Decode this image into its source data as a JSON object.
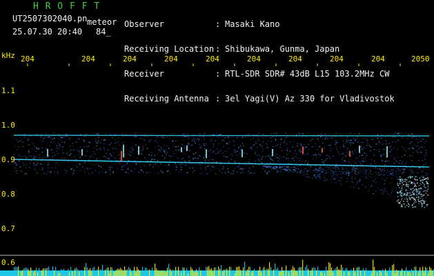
{
  "header": {
    "title": "H R O F F T",
    "filename": "UT2507302040.pn",
    "meteor_label": "meteor",
    "datetime": "25.07.30 20:40",
    "count": "84_",
    "labels": [
      "Observer",
      "Receiving Location",
      "Receiver",
      "Receiving Antenna"
    ],
    "colons": [
      ":",
      ":",
      ":",
      ":"
    ],
    "values": [
      "Masaki Kano",
      "Shibukawa, Gunma, Japan",
      "RTL-SDR SDR# 43dB L15 103.2MHz CW",
      "3el Yagi(V) Az 330 for Vladivostok"
    ]
  },
  "axes": {
    "unit": "kHz",
    "y_ticks": [
      "1.1",
      "1.0",
      "0.9",
      "0.8",
      "0.7",
      "0.6"
    ],
    "x_ticks": [
      "204",
      "204",
      "204",
      "204",
      "204",
      "204",
      "204",
      "204",
      "204",
      "2050"
    ]
  },
  "colors": {
    "title": "#3ed13e",
    "text": "#f2f2f2",
    "axis": "#ffee00",
    "signal_band": "#4a8cff",
    "trace": "#3ad7ff"
  }
}
